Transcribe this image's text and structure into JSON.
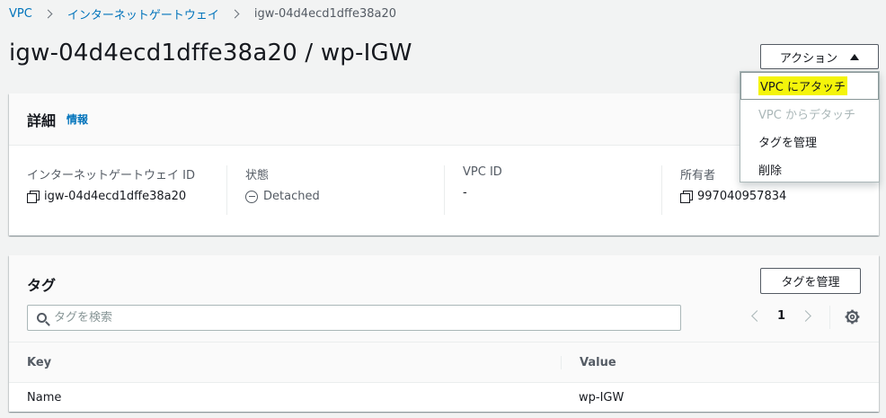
{
  "breadcrumb": {
    "items": [
      "VPC",
      "インターネットゲートウェイ"
    ],
    "current": "igw-04d4ecd1dffe38a20"
  },
  "page": {
    "title": "igw-04d4ecd1dffe38a20 / wp-IGW",
    "actions_label": "アクション"
  },
  "actions_menu": {
    "items": [
      "VPC にアタッチ",
      "VPC からデタッチ",
      "タグを管理",
      "削除"
    ]
  },
  "details": {
    "heading": "詳細",
    "info_link": "情報",
    "fields": [
      {
        "label": "インターネットゲートウェイ ID",
        "value": "igw-04d4ecd1dffe38a20"
      },
      {
        "label": "状態",
        "value": "Detached"
      },
      {
        "label": "VPC ID",
        "value": "-"
      },
      {
        "label": "所有者",
        "value": "997040957834"
      }
    ]
  },
  "tags": {
    "heading": "タグ",
    "manage_label": "タグを管理",
    "search_placeholder": "タグを検索",
    "page_number": "1",
    "columns": [
      "Key",
      "Value"
    ],
    "rows": [
      {
        "key": "Name",
        "value": "wp-IGW"
      }
    ]
  }
}
